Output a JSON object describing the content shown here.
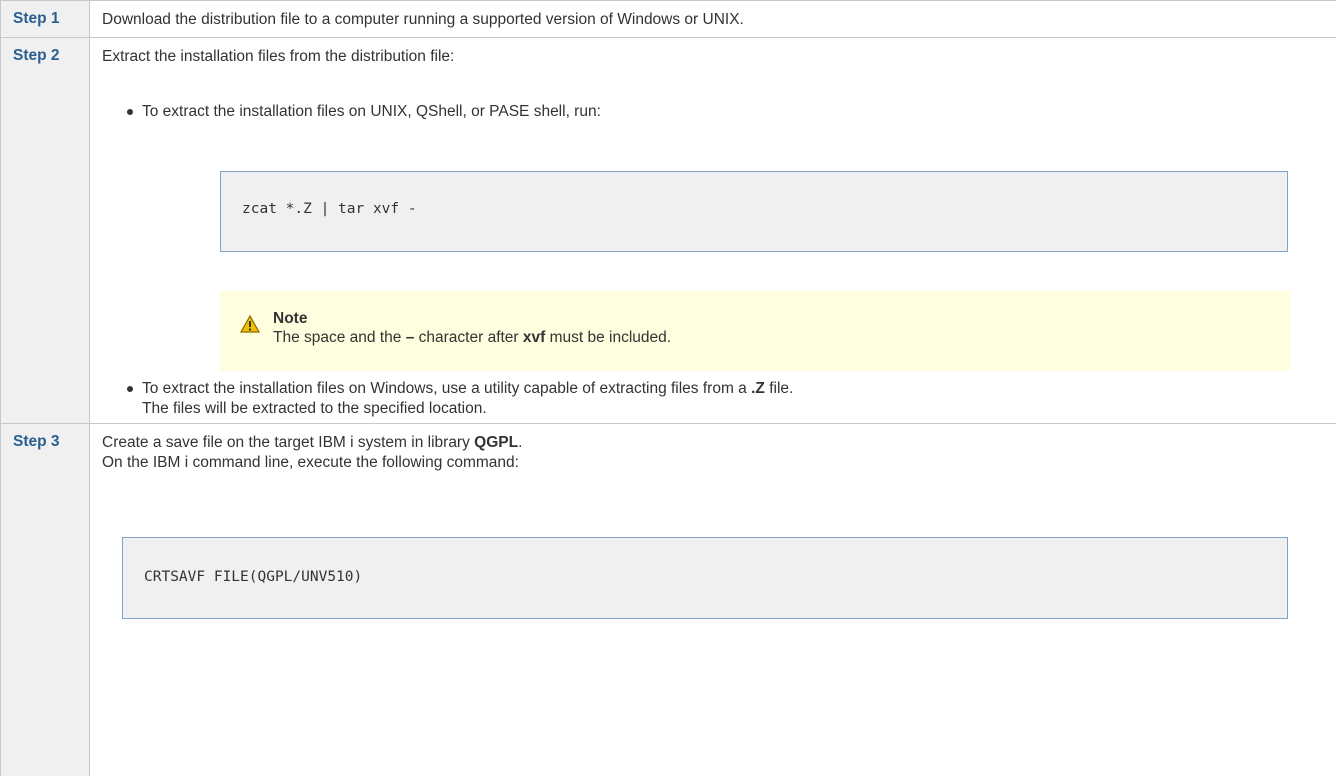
{
  "steps": [
    {
      "label": "Step 1",
      "text": "Download the distribution file to a computer running a supported version of Windows or UNIX."
    },
    {
      "label": "Step 2",
      "intro": "Extract the installation files from the distribution file:",
      "bullet1": "To extract the installation files on UNIX, QShell, or PASE shell, run:",
      "code": "zcat *.Z | tar xvf -",
      "note": {
        "title": "Note",
        "text_a": "The space and the ",
        "dash": "–",
        "text_b": " character after ",
        "bold": "xvf",
        "text_c": " must be included."
      },
      "bullet2": {
        "text_a": "To extract the installation files on Windows, use a utility capable of extracting files from a ",
        "bold": ".Z",
        "text_b": " file.",
        "line2": "The files will be extracted to the specified location."
      }
    },
    {
      "label": "Step 3",
      "text_a": "Create a save file on the target IBM i system in library ",
      "bold": "QGPL",
      "text_b": ".",
      "line2": "On the IBM i command line, execute the following command:",
      "code": "CRTSAVF FILE(QGPL/UNV510)"
    }
  ],
  "icons": {
    "note": "warning-icon"
  },
  "colors": {
    "step_label": "#2a5e91",
    "note_bg": "#ffffe0",
    "code_border": "#7fa4c8"
  }
}
